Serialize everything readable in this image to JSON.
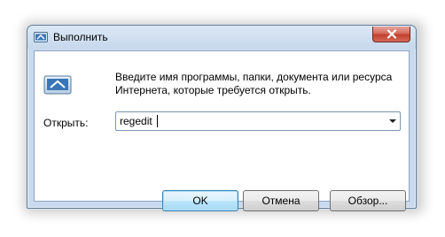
{
  "window": {
    "title": "Выполнить"
  },
  "dialog": {
    "description_line1": "Введите имя программы, папки, документа или ресурса",
    "description_line2": "Интернета, которые требуется открыть.",
    "open_label": "Открыть:",
    "open_value": "regedit"
  },
  "buttons": {
    "ok": "OK",
    "cancel": "Отмена",
    "browse": "Обзор..."
  },
  "icons": {
    "title": "run-app-icon",
    "dialog": "run-app-icon",
    "close": "close-icon",
    "dropdown": "chevron-down-icon"
  },
  "colors": {
    "frame": "#c9daee",
    "close_button": "#c94a3b",
    "default_button_border": "#3c7fb1"
  }
}
